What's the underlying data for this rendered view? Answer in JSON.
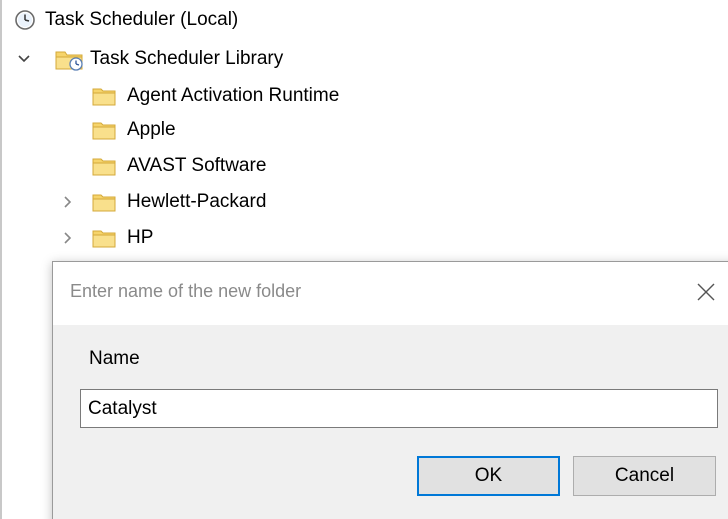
{
  "tree": {
    "root": {
      "label": "Task Scheduler (Local)",
      "icon": "clock-icon"
    },
    "library": {
      "label": "Task Scheduler Library",
      "icon": "task-folder-icon",
      "expanded": true,
      "selected": true
    },
    "folders": [
      {
        "label": "Agent Activation Runtime",
        "has_children": false
      },
      {
        "label": "Apple",
        "has_children": false
      },
      {
        "label": "AVAST Software",
        "has_children": false
      },
      {
        "label": "Hewlett-Packard",
        "has_children": true
      },
      {
        "label": "HP",
        "has_children": true
      }
    ]
  },
  "dialog": {
    "title": "Enter name of the new folder",
    "name_label": "Name",
    "name_value": "Catalyst",
    "ok_label": "OK",
    "cancel_label": "Cancel"
  },
  "colors": {
    "folder_yellow": "#f6d46b",
    "selection": "#d9d9d9",
    "dialog_bg": "#f0f0f0",
    "default_button_border": "#0078d7"
  }
}
